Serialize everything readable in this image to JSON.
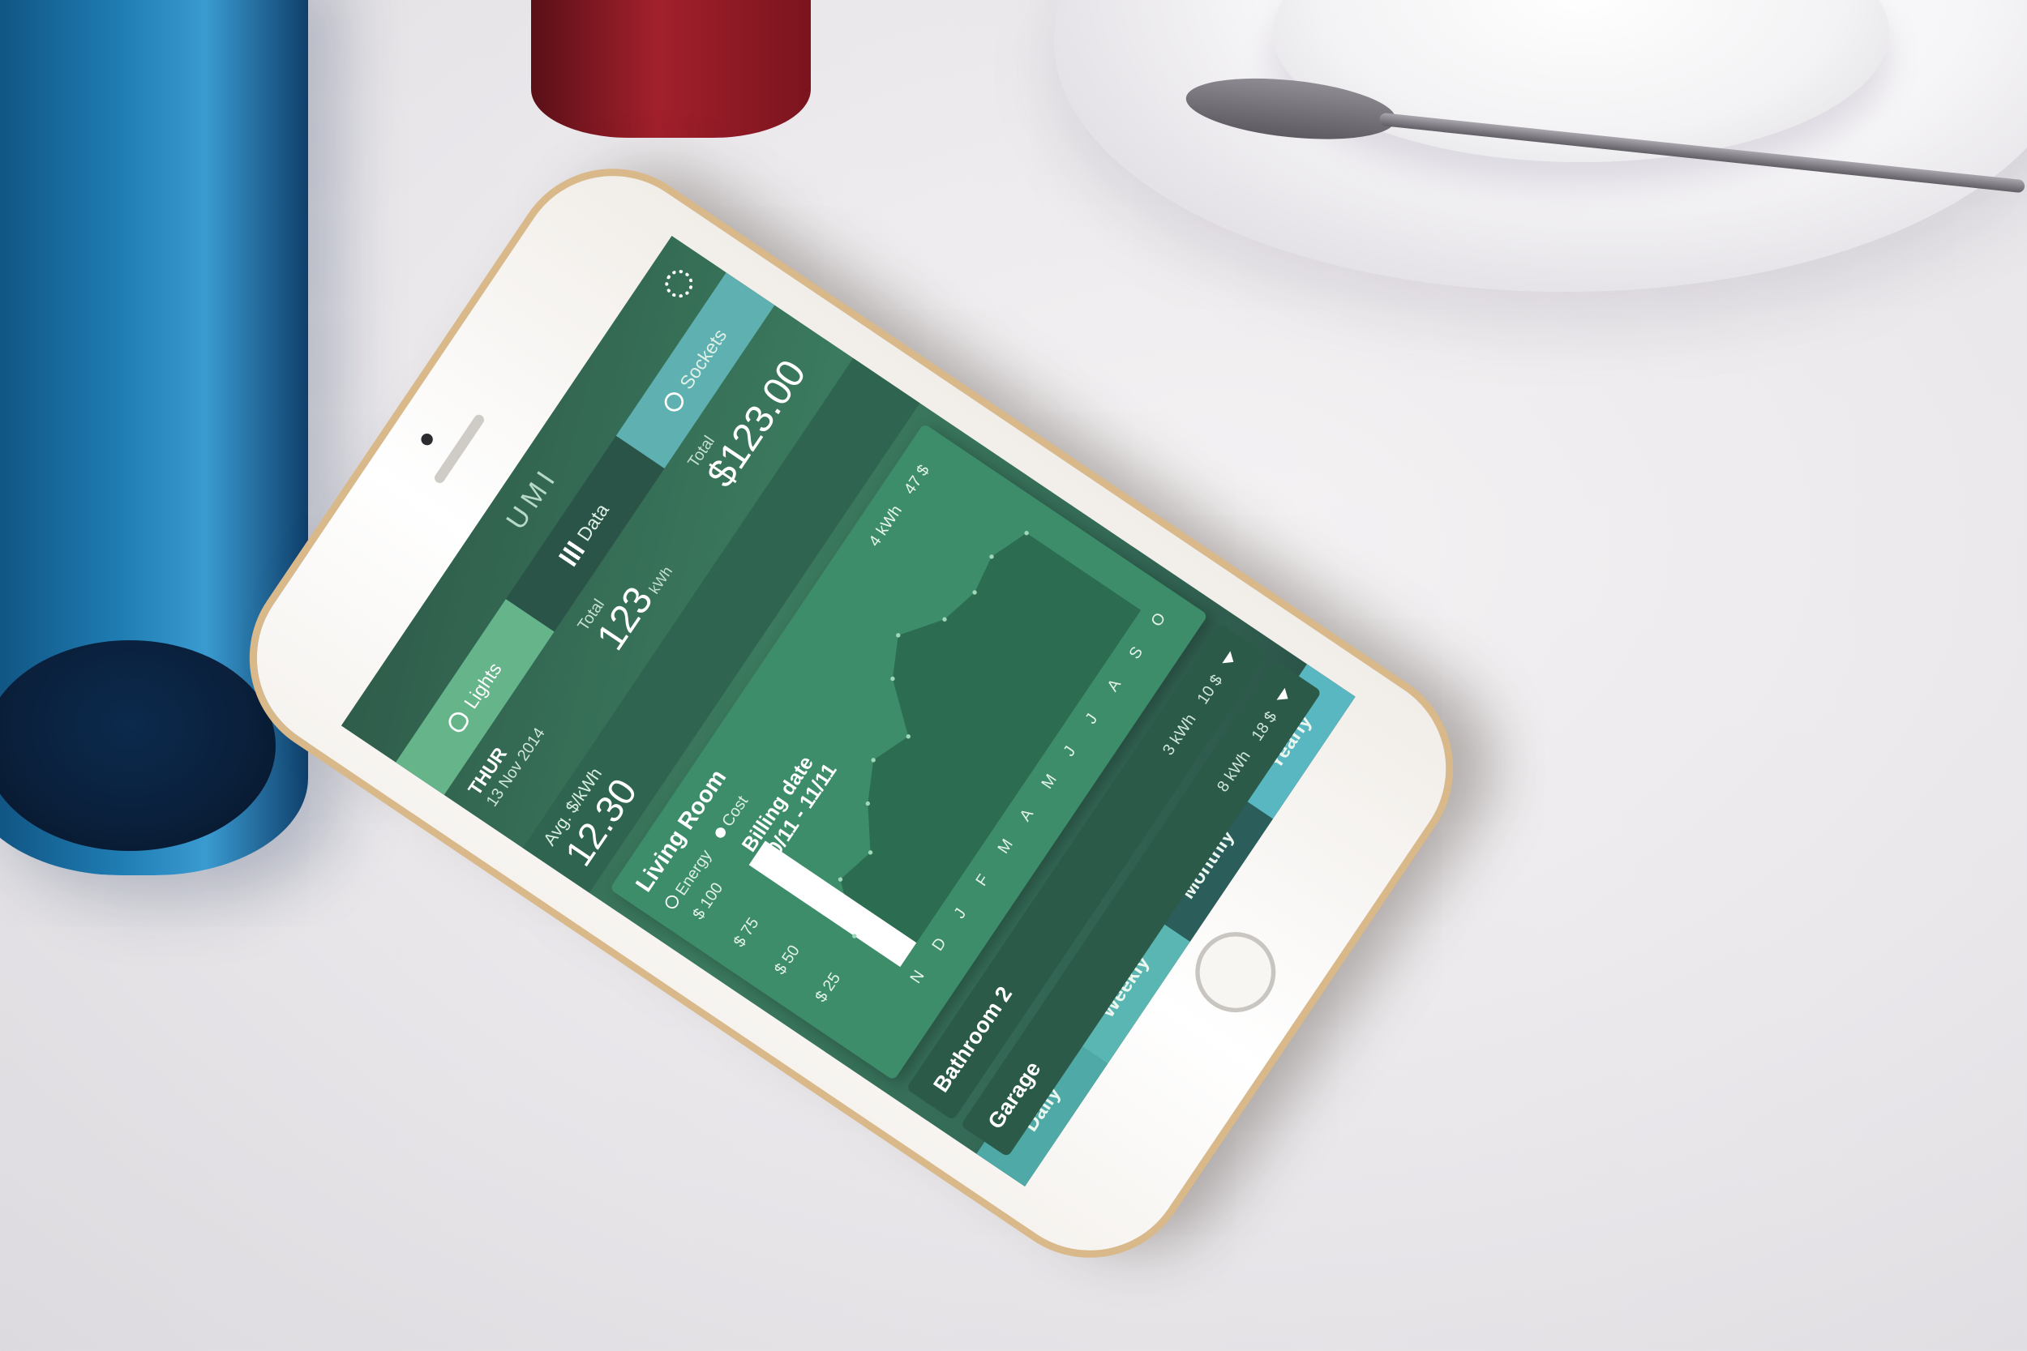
{
  "app": {
    "title": "UMI"
  },
  "tabs": [
    {
      "label": "Lights",
      "icon": "bulb-icon"
    },
    {
      "label": "Data",
      "icon": "bar-chart-icon"
    },
    {
      "label": "Sockets",
      "icon": "socket-icon"
    }
  ],
  "summary": {
    "day": "THUR",
    "date": "13 Nov 2014",
    "total_kwh_label": "Total",
    "total_kwh": "123",
    "total_kwh_unit": "kWh",
    "total_cost_label": "Total",
    "total_cost": "$123.00"
  },
  "avg": {
    "label": "Avg. $/kWh",
    "value": "12.30"
  },
  "rooms": [
    {
      "name": "Living Room",
      "kwh": "4 kWh",
      "cost": "47 $"
    },
    {
      "name": "Bathroom 2",
      "kwh": "3 kWh",
      "cost": "10 $"
    },
    {
      "name": "Garage",
      "kwh": "8 kWh",
      "cost": "18 $"
    }
  ],
  "legend": {
    "energy": "Energy",
    "cost": "Cost"
  },
  "billing": {
    "label": "Billing date",
    "range": "10/11 - 11/11"
  },
  "chart_data": {
    "type": "area",
    "categories": [
      "N",
      "D",
      "J",
      "F",
      "M",
      "A",
      "M",
      "J",
      "J",
      "A",
      "S",
      "O"
    ],
    "values": [
      28,
      50,
      45,
      60,
      70,
      62,
      85,
      95,
      80,
      75,
      78,
      70
    ],
    "y_ticks": [
      "$ 100",
      "$ 75",
      "$ 50",
      "$ 25"
    ],
    "ylim": [
      0,
      100
    ],
    "highlight_category": "N"
  },
  "periods": [
    "Daily",
    "Weekly",
    "Monthly",
    "Yearly"
  ],
  "colors": {
    "accent": "#66b48a",
    "screen_dark": "#2f5d4b",
    "phone_gold": "#d9b889"
  }
}
